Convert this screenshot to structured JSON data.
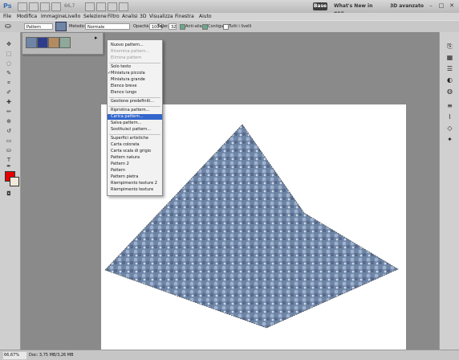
{
  "titlebar": {
    "logo": "Ps",
    "zoom": "66,7",
    "essentials_label": "Base",
    "whatsnew_label": "What's New in CS5",
    "workspace_label": "3D avanzato",
    "minimize": "–",
    "maximize": "□",
    "close": "✕"
  },
  "menubar": {
    "items": [
      "File",
      "Modifica",
      "Immagine",
      "Livello",
      "Selezione",
      "Filtro",
      "Analisi",
      "3D",
      "Visualizza",
      "Finestra",
      "Aiuto"
    ]
  },
  "options": {
    "fill_source": "Pattern",
    "method_label": "Metodo:",
    "method_value": "Normale",
    "opacity_label": "Opacità:",
    "opacity_value": "100%",
    "tolerance_label": "Toller.:",
    "tolerance_value": "32",
    "antialias_label": "Anti-alias",
    "contiguous_label": "Contigui",
    "all_layers_label": "Tutti i livelli"
  },
  "status": {
    "zoom": "66,67%",
    "doc": "Doc: 3,75 MB/3,26 MB"
  },
  "pattern_menu": {
    "items": [
      {
        "label": "Nuovo pattern...",
        "state": "normal"
      },
      {
        "label": "Rinomina pattern...",
        "state": "disabled"
      },
      {
        "label": "Elimina pattern",
        "state": "disabled"
      },
      {
        "label": "Solo testo",
        "state": "normal"
      },
      {
        "label": "Miniatura piccola",
        "state": "checked"
      },
      {
        "label": "Miniatura grande",
        "state": "normal"
      },
      {
        "label": "Elenco breve",
        "state": "normal"
      },
      {
        "label": "Elenco lungo",
        "state": "normal"
      },
      {
        "label": "Gestione predefiniti...",
        "state": "normal"
      },
      {
        "label": "Ripristina pattern...",
        "state": "normal"
      },
      {
        "label": "Carica pattern...",
        "state": "selected"
      },
      {
        "label": "Salva pattern...",
        "state": "normal"
      },
      {
        "label": "Sostituisci pattern...",
        "state": "normal"
      },
      {
        "label": "Superfici artistiche",
        "state": "normal"
      },
      {
        "label": "Carta colorata",
        "state": "normal"
      },
      {
        "label": "Carta scala di grigio",
        "state": "normal"
      },
      {
        "label": "Pattern natura",
        "state": "normal"
      },
      {
        "label": "Pattern 2",
        "state": "normal"
      },
      {
        "label": "Pattern",
        "state": "normal"
      },
      {
        "label": "Pattern pietra",
        "state": "normal"
      },
      {
        "label": "Riempimento texture 2",
        "state": "normal"
      },
      {
        "label": "Riempimento texture",
        "state": "normal"
      }
    ]
  },
  "colors": {
    "foreground": "#e40000",
    "background": "#f0e8d8",
    "menu_highlight": "#3366cc",
    "pattern_base": "#6e85a6"
  }
}
